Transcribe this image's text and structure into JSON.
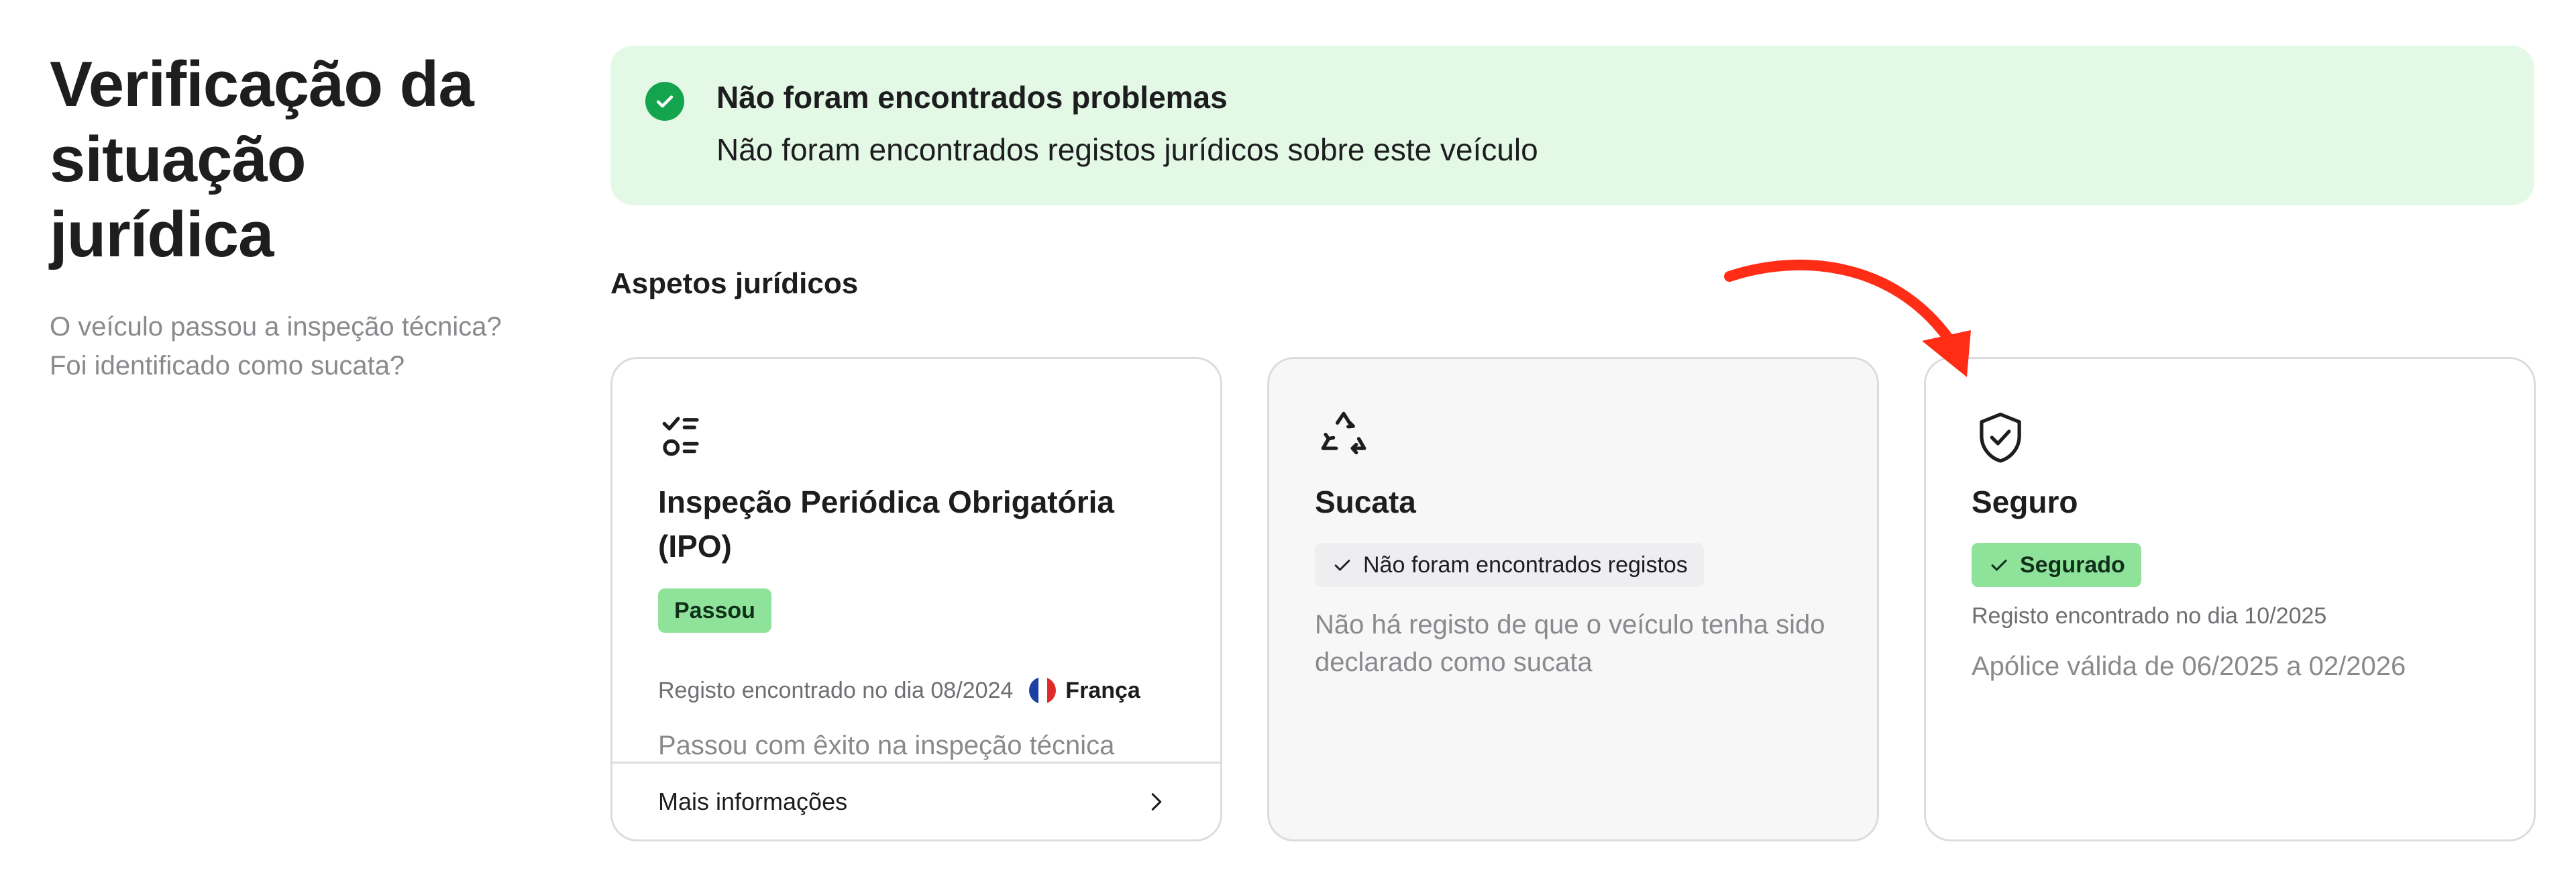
{
  "page": {
    "title_lines": [
      "Verificação da",
      "situação",
      "jurídica"
    ],
    "subtitle_lines": [
      "O veículo passou a inspeção técnica?",
      "Foi identificado como sucata?"
    ]
  },
  "banner": {
    "icon": "check-circle-icon",
    "title": "Não foram encontrados problemas",
    "subtitle": "Não foram encontrados registos jurídicos sobre este veículo",
    "accent": "#14a44d",
    "background": "#e3f9e5"
  },
  "section": {
    "title": "Aspetos jurídicos"
  },
  "cards": [
    {
      "icon": "checklist-icon",
      "title": "Inspeção Periódica Obrigatória (IPO)",
      "badge": "Passou",
      "meta": "Registo encontrado no dia 08/2024",
      "country": "França",
      "country_flag": "france-flag-icon",
      "description": "Passou com êxito na inspeção técnica",
      "footer_link": "Mais informações"
    },
    {
      "icon": "recycle-icon",
      "title": "Sucata",
      "badge": "Não foram encontrados registos",
      "description": "Não há registo de que o veículo tenha sido declarado como sucata"
    },
    {
      "icon": "shield-check-icon",
      "title": "Seguro",
      "badge": "Segurado",
      "meta": "Registo encontrado no dia 10/2025",
      "description": "Apólice válida de 06/2025 a 02/2026"
    }
  ],
  "annotation": {
    "icon": "red-arrow-icon",
    "color": "#ff2d16"
  },
  "colors": {
    "badge_green": "#8ee29a",
    "card_border": "#dcdcde"
  }
}
